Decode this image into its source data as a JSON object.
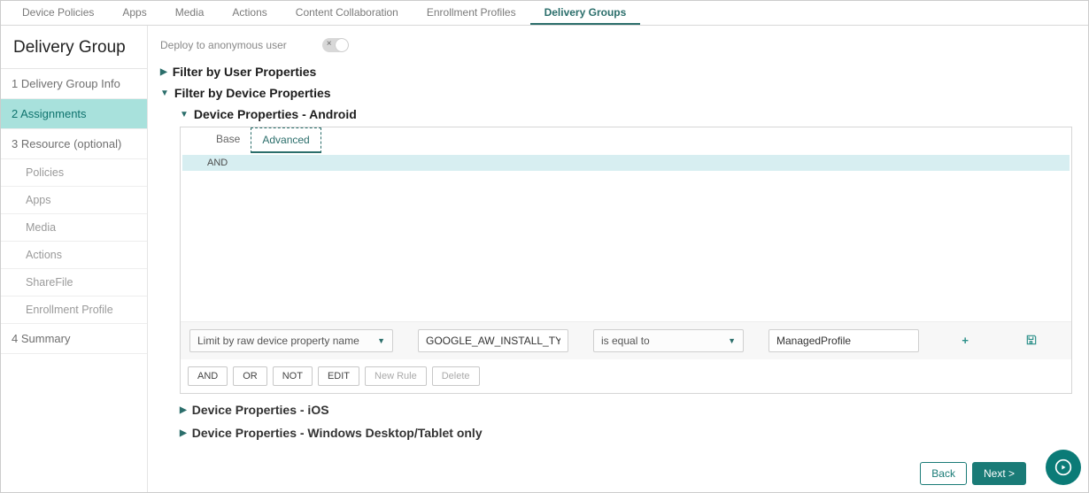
{
  "topnav": {
    "items": [
      {
        "label": "Device Policies"
      },
      {
        "label": "Apps"
      },
      {
        "label": "Media"
      },
      {
        "label": "Actions"
      },
      {
        "label": "Content Collaboration"
      },
      {
        "label": "Enrollment Profiles"
      },
      {
        "label": "Delivery Groups"
      }
    ],
    "activeIndex": 6
  },
  "sidebar": {
    "title": "Delivery Group",
    "steps": [
      {
        "label": "1  Delivery Group Info"
      },
      {
        "label": "2  Assignments",
        "active": true
      },
      {
        "label": "3  Resource (optional)",
        "children": [
          {
            "label": "Policies"
          },
          {
            "label": "Apps"
          },
          {
            "label": "Media"
          },
          {
            "label": "Actions"
          },
          {
            "label": "ShareFile"
          },
          {
            "label": "Enrollment Profile"
          }
        ]
      },
      {
        "label": "4  Summary"
      }
    ]
  },
  "deploy": {
    "label": "Deploy to anonymous user",
    "value": false,
    "x": "×"
  },
  "filters": {
    "byUser": {
      "label": "Filter by User Properties",
      "expanded": false
    },
    "byDevice": {
      "label": "Filter by Device Properties",
      "expanded": true
    },
    "android": {
      "label": "Device Properties - Android",
      "expanded": true
    },
    "ios": {
      "label": "Device Properties - iOS"
    },
    "windows": {
      "label": "Device Properties - Windows Desktop/Tablet only"
    }
  },
  "propsTabs": {
    "base": "Base",
    "advanced": "Advanced",
    "active": "advanced"
  },
  "andBar": "AND",
  "ruleRow": {
    "limitBy": "Limit by raw device property name",
    "propValue": "GOOGLE_AW_INSTALL_TYPE",
    "operator": "is equal to",
    "value": "ManagedProfile"
  },
  "logic": {
    "and": "AND",
    "or": "OR",
    "not": "NOT",
    "edit": "EDIT",
    "newRule": "New Rule",
    "delete": "Delete"
  },
  "footer": {
    "back": "Back",
    "next": "Next >"
  }
}
